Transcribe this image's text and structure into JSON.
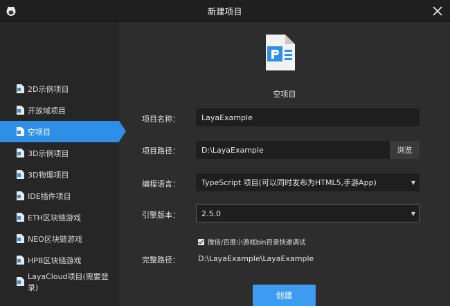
{
  "window": {
    "title": "新建项目"
  },
  "colors": {
    "accent": "#2e8fe6",
    "button": "#3d9bf0",
    "background": "#2d2d2d",
    "sidebar": "#262626",
    "field": "#1e1e1e"
  },
  "sidebar": {
    "items": [
      {
        "label": "2D示例项目",
        "active": false
      },
      {
        "label": "开放域项目",
        "active": false
      },
      {
        "label": "空项目",
        "active": true
      },
      {
        "label": "3D示例项目",
        "active": false
      },
      {
        "label": "3D物理项目",
        "active": false
      },
      {
        "label": "IDE插件项目",
        "active": false
      },
      {
        "label": "ETH区块链游戏",
        "active": false
      },
      {
        "label": "NEO区块链游戏",
        "active": false
      },
      {
        "label": "HPB区块链游戏",
        "active": false
      },
      {
        "label": "LayaCloud项目(需要登录)",
        "active": false
      }
    ]
  },
  "template": {
    "name": "空项目",
    "icon": "document-icon"
  },
  "form": {
    "project_name": {
      "label": "项目名称：",
      "value": "LayaExample"
    },
    "project_path": {
      "label": "项目路径：",
      "value": "D:\\LayaExample",
      "browse_label": "浏览"
    },
    "language": {
      "label": "编程语言：",
      "value": "TypeScript 项目(可以同时发布为HTML5,手游App)"
    },
    "engine_version": {
      "label": "引擎版本：",
      "value": "2.5.0"
    },
    "debug_checkbox": {
      "label": "微信/百度小游戏bin目录快速调试",
      "checked": true
    },
    "full_path": {
      "label": "完整路径：",
      "value": "D:\\LayaExample\\LayaExample"
    },
    "create_label": "创建"
  }
}
